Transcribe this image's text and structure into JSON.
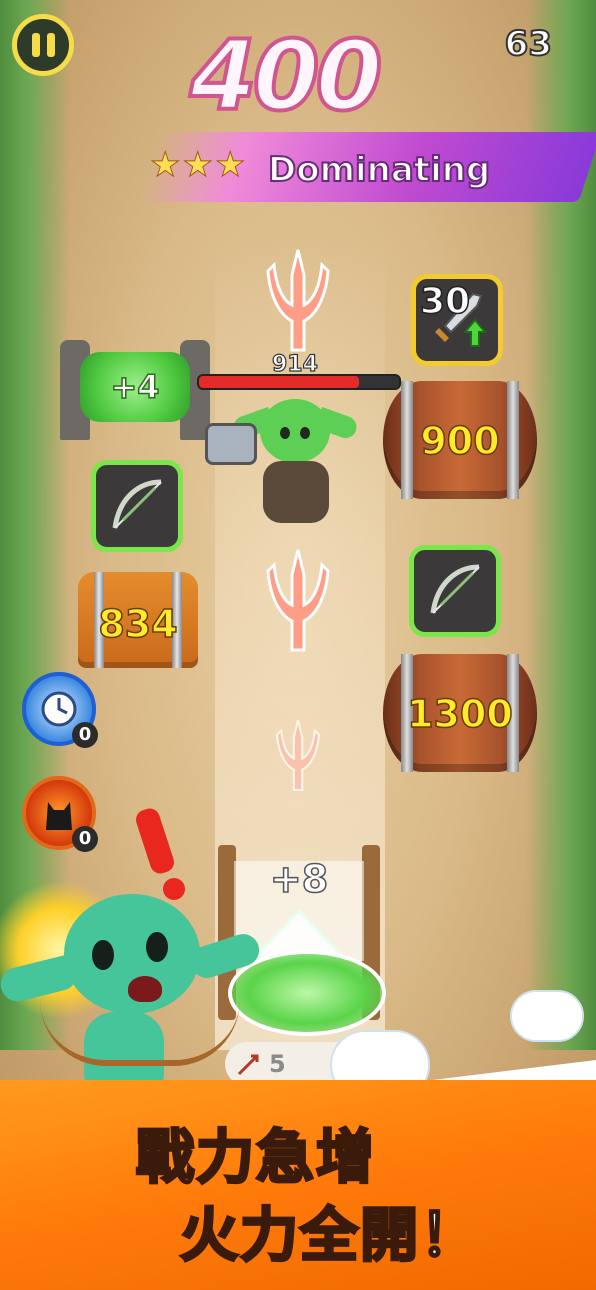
{
  "hud": {
    "counter": "63",
    "score": "400",
    "rank_label": "Dominating",
    "stars": "★★★"
  },
  "portal": {
    "bonus": "+4"
  },
  "enemy": {
    "hp": "914",
    "hp_fraction": 0.8
  },
  "upgrade_card": {
    "value": "30",
    "icon": "sword-upgrade-icon"
  },
  "barrels": [
    {
      "value": "900"
    },
    {
      "value": "1300"
    }
  ],
  "chest": {
    "value": "834"
  },
  "weapon_cards": [
    {
      "icon": "bow-icon"
    },
    {
      "icon": "bow-icon"
    }
  ],
  "skills": [
    {
      "icon": "clock-icon",
      "count": "0"
    },
    {
      "icon": "cat-icon",
      "count": "0"
    }
  ],
  "gate": {
    "label": "+8"
  },
  "ammo": {
    "value": "5"
  },
  "promo": {
    "line1": "戰力急增",
    "line2": "火力全開！"
  },
  "colors": {
    "accent_green": "#79e64a",
    "gold": "#f2cb2f",
    "value_yellow": "#ffeb28",
    "hp_red": "#e52a2a",
    "promo_orange": "#ff7a0a"
  }
}
